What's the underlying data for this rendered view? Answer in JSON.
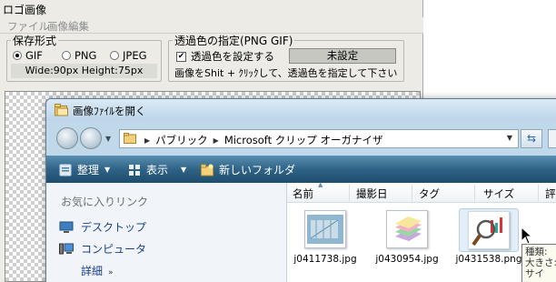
{
  "app": {
    "title": "ロゴ画像",
    "menu": [
      "ファイル",
      "画像編集"
    ]
  },
  "save_format": {
    "legend": "保存形式",
    "options": [
      {
        "label": "GIF",
        "selected": true
      },
      {
        "label": "PNG",
        "selected": false
      },
      {
        "label": "JPEG",
        "selected": false
      }
    ],
    "dimensions": "Wide:90px Height:75px"
  },
  "transparency": {
    "legend": "透過色の指定(PNG GIF)",
    "checkbox_label": "透過色を設定する",
    "checked": true,
    "button_label": "未設定",
    "hint": "画像をShit + ｸﾘｯｸして、透過色を指定して下さい"
  },
  "dialog": {
    "title": "画像ﾌｧｲﾙを開く",
    "breadcrumb": [
      "パブリック",
      "Microsoft クリップ オーガナイザ"
    ],
    "toolbar": {
      "organize": "整理",
      "view": "表示",
      "new_folder": "新しいフォルダ"
    },
    "favorites_header": "お気に入りリンク",
    "links": [
      "デスクトップ",
      "コンピュータ"
    ],
    "more": "詳細",
    "more_chevron": "»",
    "columns": [
      "名前",
      "撮影日",
      "タグ",
      "サイズ",
      "評"
    ],
    "files": [
      {
        "name": "j0411738.jpg",
        "selected": false
      },
      {
        "name": "j0430954.jpg",
        "selected": false
      },
      {
        "name": "j0431538.png",
        "selected": true
      }
    ],
    "tooltip_lines": [
      "種類:",
      "大きさ:",
      "サイ"
    ]
  },
  "colors": {
    "toolbar_dark": "#1e4d6d",
    "link_blue": "#1a3f8b",
    "window_bg": "#ecebe6"
  }
}
